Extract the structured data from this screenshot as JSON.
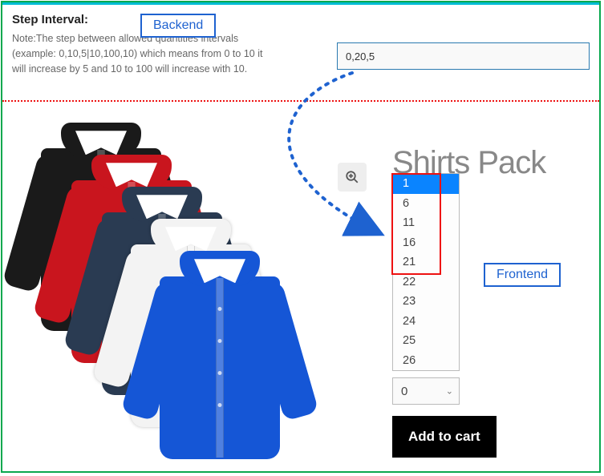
{
  "backend": {
    "step_label": "Step Interval:",
    "badge": "Backend",
    "note": "Note:The step between allowed quantities intervals (example: 0,10,5|10,100,10) which means from 0 to 10 it will increase by 5 and 10 to 100 will increase with 10.",
    "input_value": "0,20,5"
  },
  "product": {
    "title": "Shirts Pack",
    "zoom_icon": "zoom-in",
    "shirt_colors": [
      "#1a1a1a",
      "#c9151e",
      "#2a3b52",
      "#f3f3f3",
      "#1556d6"
    ]
  },
  "frontend": {
    "badge": "Frontend",
    "dropdown_options": [
      "1",
      "6",
      "11",
      "16",
      "21",
      "22",
      "23",
      "24",
      "25",
      "26"
    ],
    "dropdown_selected": "1",
    "qty_value": "0",
    "add_to_cart_label": "Add to cart"
  }
}
